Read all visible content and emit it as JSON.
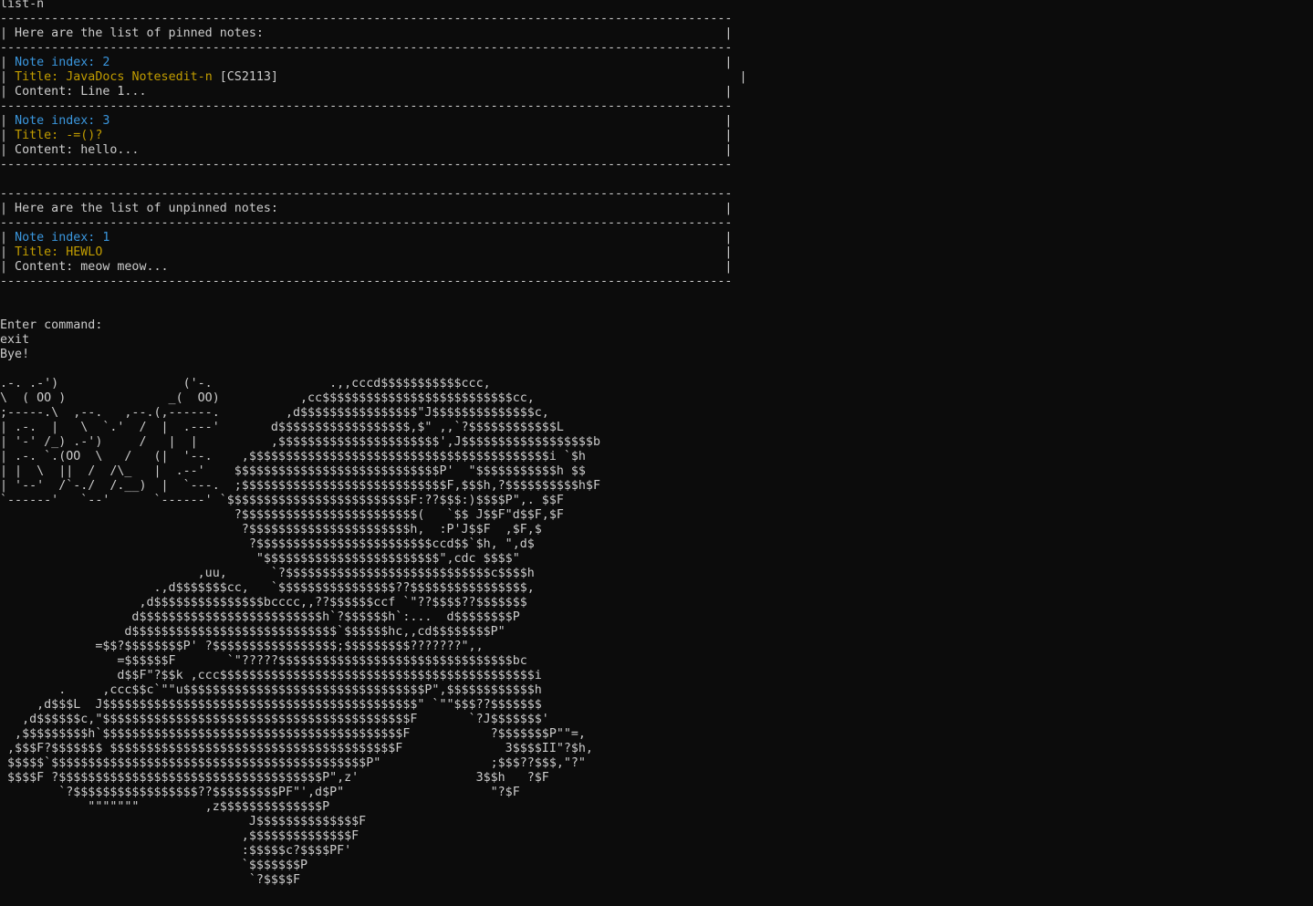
{
  "terminal": {
    "colors": {
      "background": "#0c0c0c",
      "default": "#cccccc",
      "blue": "#3a96dd",
      "yellow": "#c19c00"
    },
    "lines": [
      {
        "role": "command",
        "segments": [
          {
            "t": "list-n",
            "c": "default"
          }
        ]
      },
      {
        "role": "border",
        "segments": [
          {
            "t": "----------------------------------------------------------------------------------------------------",
            "c": "default"
          }
        ]
      },
      {
        "role": "heading",
        "segments": [
          {
            "t": "| Here are the list of pinned notes:                                                               |",
            "c": "default"
          }
        ]
      },
      {
        "role": "border",
        "segments": [
          {
            "t": "----------------------------------------------------------------------------------------------------",
            "c": "default"
          }
        ]
      },
      {
        "role": "note-index",
        "segments": [
          {
            "t": "| ",
            "c": "default"
          },
          {
            "t": "Note index: 2",
            "c": "blue"
          },
          {
            "t": "                                                                                    |",
            "c": "default"
          }
        ]
      },
      {
        "role": "note-title",
        "segments": [
          {
            "t": "| ",
            "c": "default"
          },
          {
            "t": "Title: JavaDocs Notesedit-n",
            "c": "yellow"
          },
          {
            "t": " [CS2113]",
            "c": "default"
          },
          {
            "t": "                                                               |",
            "c": "default"
          }
        ]
      },
      {
        "role": "note-content",
        "segments": [
          {
            "t": "| Content: Line 1...                                                                               |",
            "c": "default"
          }
        ]
      },
      {
        "role": "border",
        "segments": [
          {
            "t": "----------------------------------------------------------------------------------------------------",
            "c": "default"
          }
        ]
      },
      {
        "role": "note-index",
        "segments": [
          {
            "t": "| ",
            "c": "default"
          },
          {
            "t": "Note index: 3",
            "c": "blue"
          },
          {
            "t": "                                                                                    |",
            "c": "default"
          }
        ]
      },
      {
        "role": "note-title",
        "segments": [
          {
            "t": "| ",
            "c": "default"
          },
          {
            "t": "Title: -=()?",
            "c": "yellow"
          },
          {
            "t": "                                                                                     |",
            "c": "default"
          }
        ]
      },
      {
        "role": "note-content",
        "segments": [
          {
            "t": "| Content: hello...                                                                                |",
            "c": "default"
          }
        ]
      },
      {
        "role": "border",
        "segments": [
          {
            "t": "----------------------------------------------------------------------------------------------------",
            "c": "default"
          }
        ]
      },
      {
        "role": "blank",
        "segments": [
          {
            "t": "",
            "c": "default"
          }
        ]
      },
      {
        "role": "border",
        "segments": [
          {
            "t": "----------------------------------------------------------------------------------------------------",
            "c": "default"
          }
        ]
      },
      {
        "role": "heading",
        "segments": [
          {
            "t": "| Here are the list of unpinned notes:                                                             |",
            "c": "default"
          }
        ]
      },
      {
        "role": "border",
        "segments": [
          {
            "t": "----------------------------------------------------------------------------------------------------",
            "c": "default"
          }
        ]
      },
      {
        "role": "note-index",
        "segments": [
          {
            "t": "| ",
            "c": "default"
          },
          {
            "t": "Note index: 1",
            "c": "blue"
          },
          {
            "t": "                                                                                    |",
            "c": "default"
          }
        ]
      },
      {
        "role": "note-title",
        "segments": [
          {
            "t": "| ",
            "c": "default"
          },
          {
            "t": "Title: HEWLO",
            "c": "yellow"
          },
          {
            "t": "                                                                                     |",
            "c": "default"
          }
        ]
      },
      {
        "role": "note-content",
        "segments": [
          {
            "t": "| Content: meow meow...                                                                            |",
            "c": "default"
          }
        ]
      },
      {
        "role": "border",
        "segments": [
          {
            "t": "----------------------------------------------------------------------------------------------------",
            "c": "default"
          }
        ]
      },
      {
        "role": "blank",
        "segments": [
          {
            "t": "",
            "c": "default"
          }
        ]
      },
      {
        "role": "blank",
        "segments": [
          {
            "t": "",
            "c": "default"
          }
        ]
      },
      {
        "role": "prompt",
        "segments": [
          {
            "t": "Enter command:",
            "c": "default"
          }
        ]
      },
      {
        "role": "command",
        "segments": [
          {
            "t": "exit",
            "c": "default"
          }
        ]
      },
      {
        "role": "output",
        "segments": [
          {
            "t": "Bye!",
            "c": "default"
          }
        ]
      },
      {
        "role": "blank",
        "segments": [
          {
            "t": "",
            "c": "default"
          }
        ]
      },
      {
        "role": "ascii-art",
        "segments": [
          {
            "t": ".-. .-')                 ('-.                .,,cccd$$$$$$$$$$$ccc,",
            "c": "default"
          }
        ]
      },
      {
        "role": "ascii-art",
        "segments": [
          {
            "t": "\\  ( OO )              _(  OO)           ,cc$$$$$$$$$$$$$$$$$$$$$$$$$$cc,",
            "c": "default"
          }
        ]
      },
      {
        "role": "ascii-art",
        "segments": [
          {
            "t": ";-----.\\  ,--.   ,--.(,------.         ,d$$$$$$$$$$$$$$$$\"J$$$$$$$$$$$$$$c,",
            "c": "default"
          }
        ]
      },
      {
        "role": "ascii-art",
        "segments": [
          {
            "t": "| .-.  |   \\  `.'  /  |  .---'       d$$$$$$$$$$$$$$$$$$,$\" ,,`?$$$$$$$$$$$$L",
            "c": "default"
          }
        ]
      },
      {
        "role": "ascii-art",
        "segments": [
          {
            "t": "| '-' /_) .-')     /   |  |          ,$$$$$$$$$$$$$$$$$$$$$$',J$$$$$$$$$$$$$$$$$$b",
            "c": "default"
          }
        ]
      },
      {
        "role": "ascii-art",
        "segments": [
          {
            "t": "| .-. `.(OO  \\   /   (|  '--.    ,$$$$$$$$$$$$$$$$$$$$$$$$$$$$$$$$$$$$$$$$$i `$h",
            "c": "default"
          }
        ]
      },
      {
        "role": "ascii-art",
        "segments": [
          {
            "t": "| |  \\  ||  /  /\\_   |  .--'    $$$$$$$$$$$$$$$$$$$$$$$$$$$$P'  \"$$$$$$$$$$$h $$",
            "c": "default"
          }
        ]
      },
      {
        "role": "ascii-art",
        "segments": [
          {
            "t": "| '--'  /`-./  /.__)  |  `---.  ;$$$$$$$$$$$$$$$$$$$$$$$$$$$$F,$$$h,?$$$$$$$$$$h$F",
            "c": "default"
          }
        ]
      },
      {
        "role": "ascii-art",
        "segments": [
          {
            "t": "`------'   `--'      `------' `$$$$$$$$$$$$$$$$$$$$$$$$$F:??$$$:)$$$$P\",. $$F",
            "c": "default"
          }
        ]
      },
      {
        "role": "ascii-art",
        "segments": [
          {
            "t": "                                ?$$$$$$$$$$$$$$$$$$$$$$$$(   `$$ J$$F\"d$$F,$F",
            "c": "default"
          }
        ]
      },
      {
        "role": "ascii-art",
        "segments": [
          {
            "t": "                                 ?$$$$$$$$$$$$$$$$$$$$$$h,  :P'J$$F  ,$F,$",
            "c": "default"
          }
        ]
      },
      {
        "role": "ascii-art",
        "segments": [
          {
            "t": "                                  ?$$$$$$$$$$$$$$$$$$$$$$$$ccd$$`$h, \",d$",
            "c": "default"
          }
        ]
      },
      {
        "role": "ascii-art",
        "segments": [
          {
            "t": "                                   \"$$$$$$$$$$$$$$$$$$$$$$$$\",cdc $$$$\"",
            "c": "default"
          }
        ]
      },
      {
        "role": "ascii-art",
        "segments": [
          {
            "t": "                           ,uu,      `?$$$$$$$$$$$$$$$$$$$$$$$$$$$$c$$$$h",
            "c": "default"
          }
        ]
      },
      {
        "role": "ascii-art",
        "segments": [
          {
            "t": "                     .,d$$$$$$$cc,   `$$$$$$$$$$$$$$$$??$$$$$$$$$$$$$$$$,",
            "c": "default"
          }
        ]
      },
      {
        "role": "ascii-art",
        "segments": [
          {
            "t": "                   ,d$$$$$$$$$$$$$$$bcccc,,??$$$$$$ccf `\"??$$$$??$$$$$$$",
            "c": "default"
          }
        ]
      },
      {
        "role": "ascii-art",
        "segments": [
          {
            "t": "                  d$$$$$$$$$$$$$$$$$$$$$$$$$h`?$$$$$$h`:...  d$$$$$$$$P",
            "c": "default"
          }
        ]
      },
      {
        "role": "ascii-art",
        "segments": [
          {
            "t": "                 d$$$$$$$$$$$$$$$$$$$$$$$$$$$$`$$$$$$hc,,cd$$$$$$$$P\"",
            "c": "default"
          }
        ]
      },
      {
        "role": "ascii-art",
        "segments": [
          {
            "t": "             =$$?$$$$$$$$P' ?$$$$$$$$$$$$$$$$$;$$$$$$$$$???????\",,",
            "c": "default"
          }
        ]
      },
      {
        "role": "ascii-art",
        "segments": [
          {
            "t": "                =$$$$$$F       `\"?????$$$$$$$$$$$$$$$$$$$$$$$$$$$$$$$$bc",
            "c": "default"
          }
        ]
      },
      {
        "role": "ascii-art",
        "segments": [
          {
            "t": "                d$$F\"?$$k ,ccc$$$$$$$$$$$$$$$$$$$$$$$$$$$$$$$$$$$$$$$$$$$i",
            "c": "default"
          }
        ]
      },
      {
        "role": "ascii-art",
        "segments": [
          {
            "t": "        .     ,ccc$$c`\"\"u$$$$$$$$$$$$$$$$$$$$$$$$$$$$$$$$$P\",$$$$$$$$$$$$h",
            "c": "default"
          }
        ]
      },
      {
        "role": "ascii-art",
        "segments": [
          {
            "t": "     ,d$$$L  J$$$$$$$$$$$$$$$$$$$$$$$$$$$$$$$$$$$$$$$$$$$\" `\"\"$$$??$$$$$$$",
            "c": "default"
          }
        ]
      },
      {
        "role": "ascii-art",
        "segments": [
          {
            "t": "   ,d$$$$$$c,\"$$$$$$$$$$$$$$$$$$$$$$$$$$$$$$$$$$$$$$$$$$F       `?J$$$$$$$'",
            "c": "default"
          }
        ]
      },
      {
        "role": "ascii-art",
        "segments": [
          {
            "t": "  ,$$$$$$$$$h`$$$$$$$$$$$$$$$$$$$$$$$$$$$$$$$$$$$$$$$$$F           ?$$$$$$$P\"\"=,",
            "c": "default"
          }
        ]
      },
      {
        "role": "ascii-art",
        "segments": [
          {
            "t": " ,$$$F?$$$$$$$ $$$$$$$$$$$$$$$$$$$$$$$$$$$$$$$$$$$$$$$F              3$$$$II\"?$h,",
            "c": "default"
          }
        ]
      },
      {
        "role": "ascii-art",
        "segments": [
          {
            "t": " $$$$$`$$$$$$$$$$$$$$$$$$$$$$$$$$$$$$$$$$$$$$$$$$$P\"               ;$$$??$$$,\"?\"",
            "c": "default"
          }
        ]
      },
      {
        "role": "ascii-art",
        "segments": [
          {
            "t": " $$$$F ?$$$$$$$$$$$$$$$$$$$$$$$$$$$$$$$$$$$$P\",z'                3$$h   ?$F",
            "c": "default"
          }
        ]
      },
      {
        "role": "ascii-art",
        "segments": [
          {
            "t": "        `?$$$$$$$$$$$$$$$$$??$$$$$$$$$PF\"',d$P\"                    \"?$F",
            "c": "default"
          }
        ]
      },
      {
        "role": "ascii-art",
        "segments": [
          {
            "t": "            \"\"\"\"\"\"\"         ,z$$$$$$$$$$$$$$P",
            "c": "default"
          }
        ]
      },
      {
        "role": "ascii-art",
        "segments": [
          {
            "t": "                                  J$$$$$$$$$$$$$$F",
            "c": "default"
          }
        ]
      },
      {
        "role": "ascii-art",
        "segments": [
          {
            "t": "                                 ,$$$$$$$$$$$$$$F",
            "c": "default"
          }
        ]
      },
      {
        "role": "ascii-art",
        "segments": [
          {
            "t": "                                 :$$$$$c?$$$$PF'",
            "c": "default"
          }
        ]
      },
      {
        "role": "ascii-art",
        "segments": [
          {
            "t": "                                 `$$$$$$$P",
            "c": "default"
          }
        ]
      },
      {
        "role": "ascii-art",
        "segments": [
          {
            "t": "                                  `?$$$$F",
            "c": "default"
          }
        ]
      }
    ]
  }
}
